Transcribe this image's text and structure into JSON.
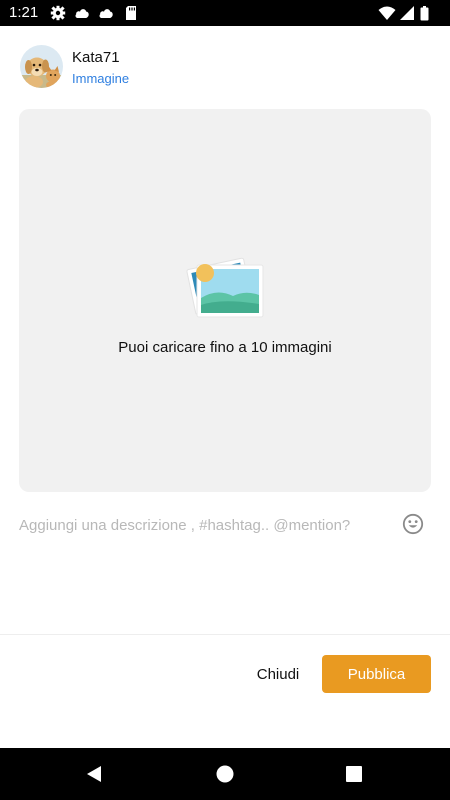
{
  "status_bar": {
    "time": "1:21",
    "left_icons": [
      "gear-icon",
      "cloud-icon",
      "cloud-icon",
      "sd-card-icon"
    ],
    "right_icons": [
      "wifi-icon",
      "signal-icon",
      "battery-icon"
    ]
  },
  "header": {
    "username": "Kata71",
    "post_type": "Immagine",
    "avatar_icon": "dog-and-cat-avatar"
  },
  "upload": {
    "icon": "image-gallery-icon",
    "hint": "Puoi caricare fino a 10 immagini"
  },
  "description": {
    "placeholder": "Aggiungi una descrizione , #hashtag.. @mention?",
    "value": "",
    "emoji_icon": "smiley-icon"
  },
  "footer": {
    "close_label": "Chiudi",
    "publish_label": "Pubblica"
  },
  "nav_bar": {
    "icons": [
      "back-icon",
      "home-icon",
      "recents-icon"
    ]
  },
  "colors": {
    "accent": "#e99a21",
    "link": "#2f7fe0",
    "upload_bg": "#f1f1f1",
    "system_bar": "#000000"
  }
}
